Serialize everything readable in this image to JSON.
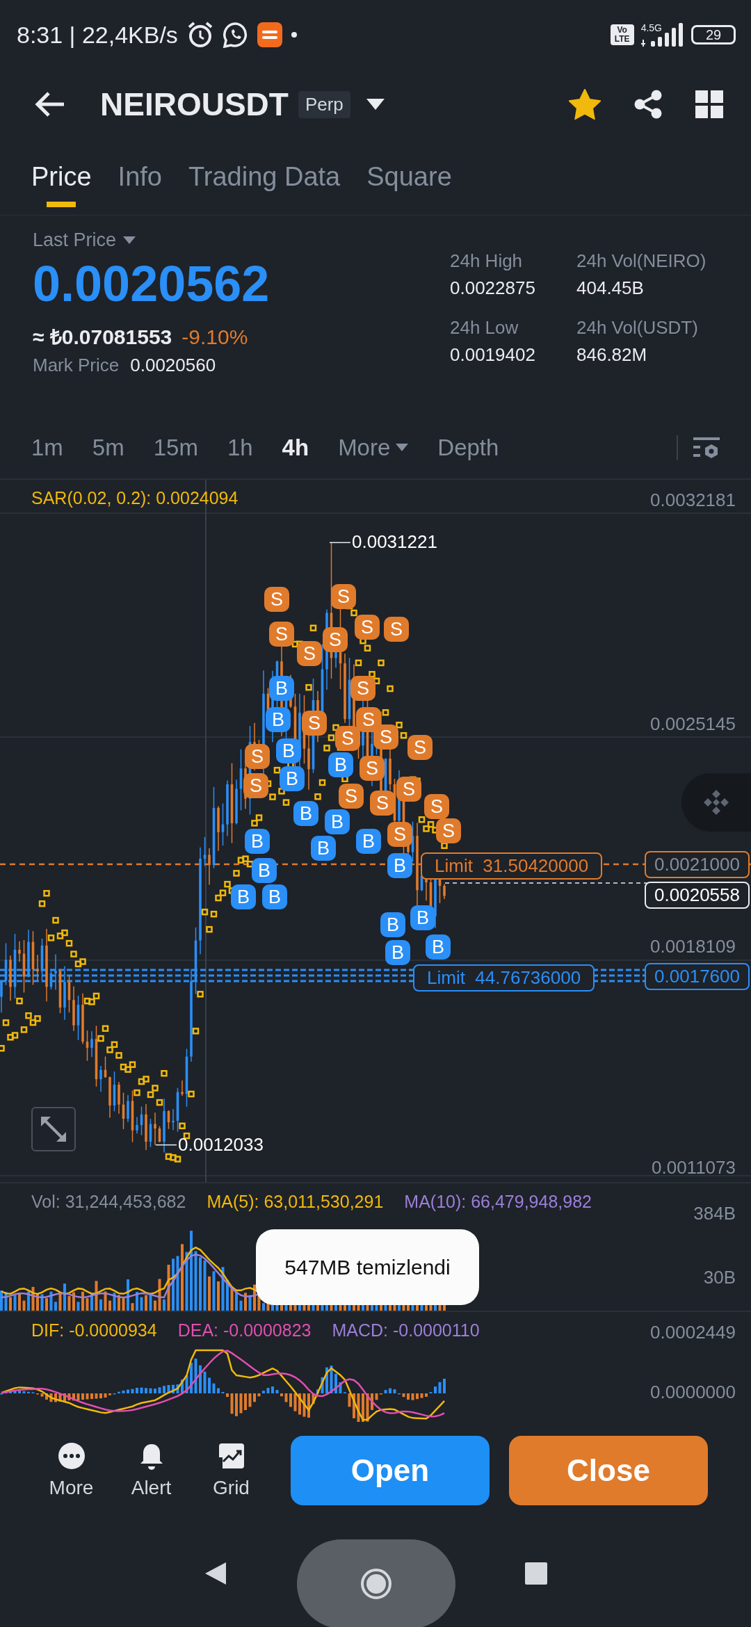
{
  "status_bar": {
    "time": "8:31 | 22,4KB/s",
    "volte": "Vo LTE",
    "network": "4.5G",
    "battery": "29"
  },
  "header": {
    "symbol": "NEIROUSDT",
    "badge": "Perp",
    "favorite": true
  },
  "tabs": [
    {
      "label": "Price",
      "selected": true
    },
    {
      "label": "Info",
      "selected": false
    },
    {
      "label": "Trading Data",
      "selected": false
    },
    {
      "label": "Square",
      "selected": false
    }
  ],
  "price_panel": {
    "label": "Last Price",
    "price": "0.0020562",
    "converted": "≈ ₺0.07081553",
    "change": "-9.10%",
    "mark_label": "Mark Price",
    "mark_value": "0.0020560",
    "stats": [
      {
        "label": "24h High",
        "value": "0.0022875"
      },
      {
        "label": "24h Vol(NEIRO)",
        "value": "404.45B"
      },
      {
        "label": "24h Low",
        "value": "0.0019402"
      },
      {
        "label": "24h Vol(USDT)",
        "value": "846.82M"
      }
    ]
  },
  "intervals": [
    {
      "label": "1m",
      "selected": false,
      "kind": "plain"
    },
    {
      "label": "5m",
      "selected": false,
      "kind": "plain"
    },
    {
      "label": "15m",
      "selected": false,
      "kind": "plain"
    },
    {
      "label": "1h",
      "selected": false,
      "kind": "plain"
    },
    {
      "label": "4h",
      "selected": true,
      "kind": "plain"
    },
    {
      "label": "More",
      "selected": false,
      "kind": "dropdown"
    },
    {
      "label": "Depth",
      "selected": false,
      "kind": "plain"
    }
  ],
  "chart": {
    "indicator": "SAR(0.02, 0.2): 0.0024094",
    "axis_labels": [
      "0.0032181",
      "0.0025145",
      "0.0018109",
      "0.0011073"
    ],
    "high_label": "0.0031221",
    "low_label": "0.0012033",
    "last_price": "0.0020558",
    "orders": [
      {
        "label": "Limit  31.50420000",
        "price": "0.0021000",
        "kind": "sell"
      },
      {
        "label": "Limit  44.76736000",
        "price": "0.0017600",
        "kind": "buy"
      }
    ],
    "markers": [
      {
        "label": "S",
        "kind": "sell"
      },
      {
        "label": "S",
        "kind": "sell"
      },
      {
        "label": "S",
        "kind": "sell"
      },
      {
        "label": "S",
        "kind": "sell"
      },
      {
        "label": "S",
        "kind": "sell"
      },
      {
        "label": "S",
        "kind": "sell"
      },
      {
        "label": "S",
        "kind": "sell"
      },
      {
        "label": "B",
        "kind": "buy"
      },
      {
        "label": "S",
        "kind": "sell"
      },
      {
        "label": "B",
        "kind": "buy"
      },
      {
        "label": "S",
        "kind": "sell"
      },
      {
        "label": "S",
        "kind": "sell"
      },
      {
        "label": "S",
        "kind": "sell"
      },
      {
        "label": "S",
        "kind": "sell"
      },
      {
        "label": "S",
        "kind": "sell"
      },
      {
        "label": "S",
        "kind": "sell"
      },
      {
        "label": "B",
        "kind": "buy"
      },
      {
        "label": "B",
        "kind": "buy"
      },
      {
        "label": "S",
        "kind": "sell"
      },
      {
        "label": "B",
        "kind": "buy"
      },
      {
        "label": "S",
        "kind": "sell"
      },
      {
        "label": "S",
        "kind": "sell"
      },
      {
        "label": "S",
        "kind": "sell"
      },
      {
        "label": "S",
        "kind": "sell"
      },
      {
        "label": "S",
        "kind": "sell"
      },
      {
        "label": "B",
        "kind": "buy"
      },
      {
        "label": "B",
        "kind": "buy"
      },
      {
        "label": "S",
        "kind": "sell"
      },
      {
        "label": "S",
        "kind": "sell"
      },
      {
        "label": "B",
        "kind": "buy"
      },
      {
        "label": "B",
        "kind": "buy"
      },
      {
        "label": "B",
        "kind": "buy"
      },
      {
        "label": "B",
        "kind": "buy"
      },
      {
        "label": "B",
        "kind": "buy"
      },
      {
        "label": "B",
        "kind": "buy"
      },
      {
        "label": "B",
        "kind": "buy"
      },
      {
        "label": "B",
        "kind": "buy"
      },
      {
        "label": "B",
        "kind": "buy"
      },
      {
        "label": "B",
        "kind": "buy"
      },
      {
        "label": "B",
        "kind": "buy"
      }
    ]
  },
  "volume": {
    "legend": [
      {
        "text": "Vol: 31,244,453,682",
        "color": "#848e9c"
      },
      {
        "text": "MA(5): 63,011,530,291",
        "color": "#f0b90b"
      },
      {
        "text": "MA(10): 66,479,948,982",
        "color": "#9c7fd9"
      }
    ],
    "axis_labels": [
      "384B",
      "30B"
    ]
  },
  "macd": {
    "legend": [
      {
        "text": "DIF: -0.0000934",
        "color": "#f0b90b"
      },
      {
        "text": "DEA: -0.0000823",
        "color": "#e04fb0"
      },
      {
        "text": "MACD: -0.0000110",
        "color": "#9c7fd9"
      }
    ],
    "axis_labels": [
      "0.0002449",
      "0.0000000"
    ]
  },
  "toast": "547MB temizlendi",
  "bottom_bar": {
    "actions": [
      {
        "label": "More",
        "kind": "more"
      },
      {
        "label": "Alert",
        "kind": "alert"
      },
      {
        "label": "Grid",
        "kind": "grid"
      }
    ],
    "open": "Open",
    "close": "Close"
  }
}
